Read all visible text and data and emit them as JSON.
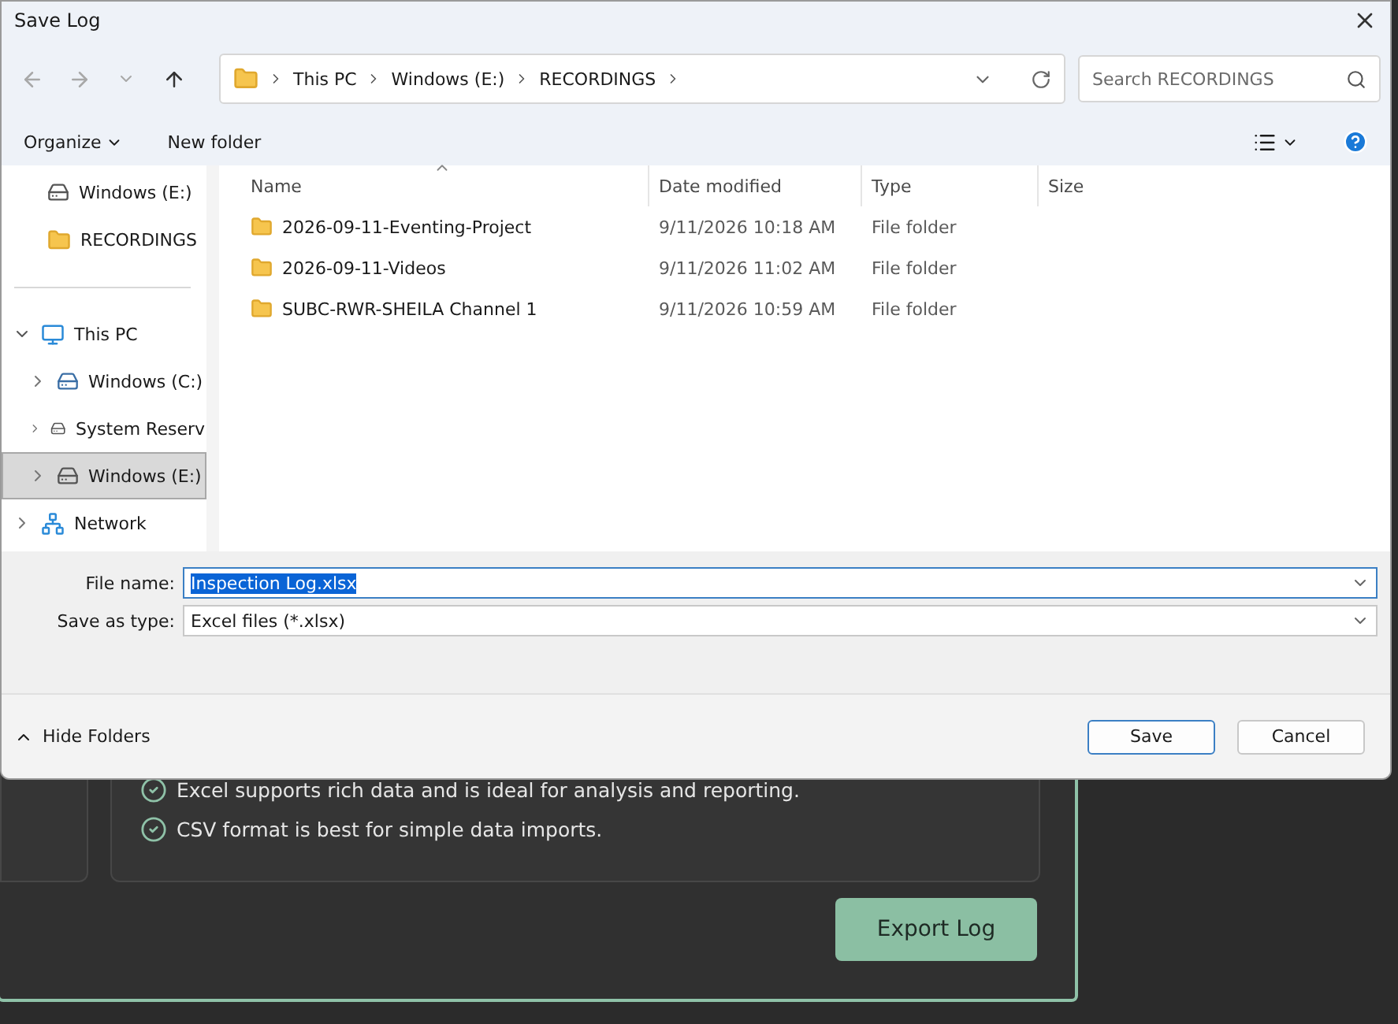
{
  "window": {
    "title": "Save Log"
  },
  "address": {
    "path": [
      "This PC",
      "Windows (E:)",
      "RECORDINGS"
    ]
  },
  "search": {
    "placeholder": "Search RECORDINGS"
  },
  "toolbar": {
    "organize": "Organize",
    "new_folder": "New folder"
  },
  "sidebar": {
    "pinned": [
      {
        "label": "Windows (E:)",
        "kind": "drive",
        "selected": false
      },
      {
        "label": "RECORDINGS",
        "kind": "folder",
        "selected": false
      }
    ],
    "tree": [
      {
        "label": "This PC",
        "kind": "pc",
        "expanded": true,
        "selected": false,
        "children": [
          {
            "label": "Windows (C:)",
            "kind": "system-drive",
            "expanded": false,
            "selected": false
          },
          {
            "label": "System Reserv",
            "kind": "drive",
            "expanded": false,
            "selected": false
          },
          {
            "label": "Windows (E:)",
            "kind": "drive",
            "expanded": false,
            "selected": true
          }
        ]
      },
      {
        "label": "Network",
        "kind": "network",
        "expanded": false,
        "selected": false
      }
    ]
  },
  "table": {
    "columns": [
      "Name",
      "Date modified",
      "Type",
      "Size"
    ],
    "rows": [
      {
        "name": "2026-09-11-Eventing-Project",
        "date": "9/11/2026 10:18 AM",
        "type": "File folder"
      },
      {
        "name": "2026-09-11-Videos",
        "date": "9/11/2026 11:02 AM",
        "type": "File folder"
      },
      {
        "name": "SUBC-RWR-SHEILA Channel 1",
        "date": "9/11/2026 10:59 AM",
        "type": "File folder"
      }
    ]
  },
  "file_name": {
    "label": "File name:",
    "value": "Inspection Log.xlsx",
    "highlighted": true
  },
  "save_as_type": {
    "label": "Save as type:",
    "value": "Excel files (*.xlsx)"
  },
  "hide_folders": "Hide Folders",
  "buttons": [
    {
      "label": "Save",
      "kind": "primary"
    },
    {
      "label": "Cancel",
      "kind": "secondary"
    }
  ],
  "background": {
    "notes": [
      "Excel supports rich data and is ideal for analysis and reporting.",
      "CSV format is best for simple data imports."
    ],
    "export_button": "Export Log"
  }
}
